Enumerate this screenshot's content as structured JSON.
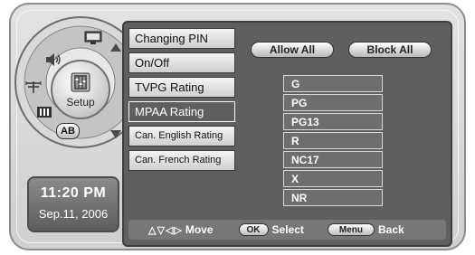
{
  "dial": {
    "center_label": "Setup",
    "items": [
      {
        "label": "",
        "icon": "monitor-icon"
      },
      {
        "label": "",
        "icon": "speaker-icon"
      },
      {
        "label": "",
        "icon": "antenna-icon"
      },
      {
        "label": "",
        "icon": "channel-list-icon"
      },
      {
        "label": "AB",
        "icon": "ab-input-icon"
      }
    ]
  },
  "clock": {
    "time": "11:20 PM",
    "date": "Sep.11, 2006"
  },
  "menu": {
    "items": [
      {
        "label": "Changing PIN",
        "selected": false
      },
      {
        "label": "On/Off",
        "selected": false
      },
      {
        "label": "TVPG Rating",
        "selected": false
      },
      {
        "label": "MPAA Rating",
        "selected": true
      },
      {
        "label": "Can. English Rating",
        "selected": false
      },
      {
        "label": "Can. French Rating",
        "selected": false
      }
    ]
  },
  "actions": {
    "allow_all": "Allow All",
    "block_all": "Block All"
  },
  "ratings": [
    "G",
    "PG",
    "PG13",
    "R",
    "NC17",
    "X",
    "NR"
  ],
  "footer": {
    "move_keys": "△▽◁▷",
    "move_label": "Move",
    "ok_key": "OK",
    "select_label": "Select",
    "menu_key": "Menu",
    "back_label": "Back"
  },
  "colors": {
    "panel": "#5f5f5f",
    "selected_item": "#5f5f5f",
    "frame": "#d8d8d8"
  }
}
